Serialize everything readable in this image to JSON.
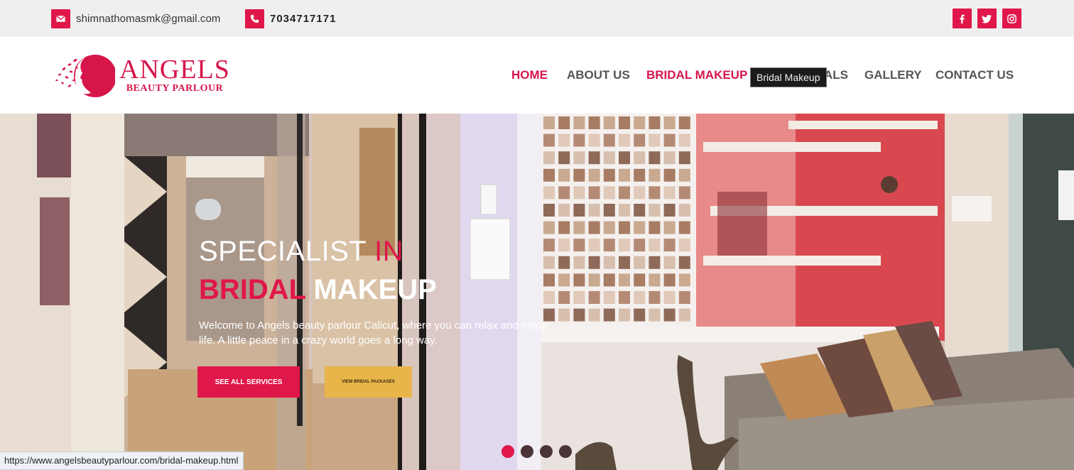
{
  "topbar": {
    "email": "shimnathomasmk@gmail.com",
    "phone": "7034717171",
    "social": [
      "facebook-icon",
      "twitter-icon",
      "instagram-icon"
    ]
  },
  "logo": {
    "title": "ANGELS",
    "subtitle": "BEAUTY PARLOUR"
  },
  "nav": {
    "items": [
      {
        "label": "HOME",
        "active": true
      },
      {
        "label": "ABOUT US",
        "active": false
      },
      {
        "label": "BRIDAL MAKEUP",
        "active": false,
        "hover": true
      },
      {
        "label": "ALS",
        "active": false
      },
      {
        "label": "GALLERY",
        "active": false
      },
      {
        "label": "CONTACT US",
        "active": false
      }
    ],
    "tooltip": "Bridal Makeup"
  },
  "hero": {
    "title_line1_a": "SPECIALIST ",
    "title_line1_b": "IN",
    "title_line2_a": "BRIDAL",
    "title_line2_b": " MAKEUP",
    "description": "Welcome to Angels beauty parlour Calicut, where you can relax and enjoy life. A little peace in a crazy world goes a long way.",
    "button_services": "SEE ALL SERVICES",
    "button_packages": "VIEW BRIDAL PACKAGES",
    "slides_count": 4,
    "active_slide": 1
  },
  "statusbar": {
    "url": "https://www.angelsbeautyparlour.com/bridal-makeup.html"
  },
  "colors": {
    "accent": "#e0174a",
    "gold": "#e8b54a",
    "topbar_bg": "#efefef"
  }
}
